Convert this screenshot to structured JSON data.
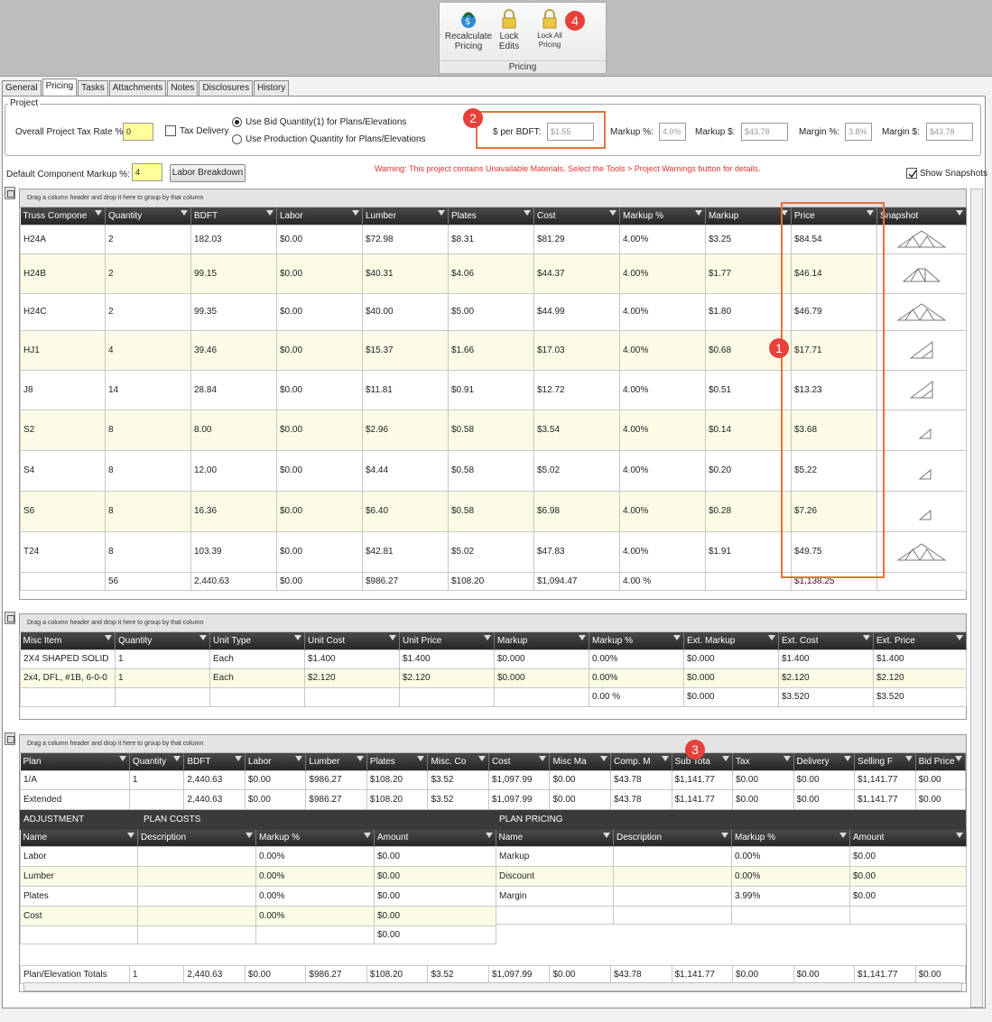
{
  "ribbon": {
    "recalc": "Recalculate Pricing",
    "lock_edits": "Lock Edits",
    "lock_all": "Lock All Pricing",
    "group": "Pricing",
    "badge": "4"
  },
  "tabs": [
    "General",
    "Pricing",
    "Tasks",
    "Attachments",
    "Notes",
    "Disclosures",
    "History"
  ],
  "project": {
    "legend": "Project",
    "tax_rate_label": "Overall Project Tax Rate %:",
    "tax_rate": "0",
    "tax_delivery": "Tax Delivery",
    "radio1": "Use Bid Quantity(1) for Plans/Elevations",
    "radio2": "Use Production Quantity for Plans/Elevations",
    "per_bdft_label": "$ per BDFT:",
    "per_bdft": "$1.55",
    "markup_pct_label": "Markup %:",
    "markup_pct": "4.0%",
    "markup_usd_label": "Markup $:",
    "markup_usd": "$43.78",
    "margin_pct_label": "Margin %:",
    "margin_pct": "3.8%",
    "margin_usd_label": "Margin $:",
    "margin_usd": "$43.78",
    "badge": "2"
  },
  "component": {
    "markup_label": "Default Component Markup %:",
    "markup": "4",
    "labor_btn": "Labor Breakdown",
    "warning": "Warning: This project contains Unavailable Materials. Select the Tools > Project Warnings button for details.",
    "show_snapshots": "Show Snapshots"
  },
  "drag_hint": "Drag a column header and drop it here to group by that column",
  "truss": {
    "headers": [
      "Truss Compone",
      "Quantity",
      "BDFT",
      "Labor",
      "Lumber",
      "Plates",
      "Cost",
      "Markup %",
      "Markup",
      "Price",
      "Snapshot"
    ],
    "rows": [
      [
        "H24A",
        "2",
        "182.03",
        "$0.00",
        "$72.98",
        "$8.31",
        "$81.29",
        "4.00%",
        "$3.25",
        "$84.54"
      ],
      [
        "H24B",
        "2",
        "99.15",
        "$0.00",
        "$40.31",
        "$4.06",
        "$44.37",
        "4.00%",
        "$1.77",
        "$46.14"
      ],
      [
        "H24C",
        "2",
        "99.35",
        "$0.00",
        "$40.00",
        "$5.00",
        "$44.99",
        "4.00%",
        "$1.80",
        "$46.79"
      ],
      [
        "HJ1",
        "4",
        "39.46",
        "$0.00",
        "$15.37",
        "$1.66",
        "$17.03",
        "4.00%",
        "$0.68",
        "$17.71"
      ],
      [
        "J8",
        "14",
        "28.84",
        "$0.00",
        "$11.81",
        "$0.91",
        "$12.72",
        "4.00%",
        "$0.51",
        "$13.23"
      ],
      [
        "S2",
        "8",
        "8.00",
        "$0.00",
        "$2.96",
        "$0.58",
        "$3.54",
        "4.00%",
        "$0.14",
        "$3.68"
      ],
      [
        "S4",
        "8",
        "12.00",
        "$0.00",
        "$4.44",
        "$0.58",
        "$5.02",
        "4.00%",
        "$0.20",
        "$5.22"
      ],
      [
        "S6",
        "8",
        "16.36",
        "$0.00",
        "$6.40",
        "$0.58",
        "$6.98",
        "4.00%",
        "$0.28",
        "$7.26"
      ],
      [
        "T24",
        "8",
        "103.39",
        "$0.00",
        "$42.81",
        "$5.02",
        "$47.83",
        "4.00%",
        "$1.91",
        "$49.75"
      ]
    ],
    "totals": [
      "",
      "56",
      "2,440.63",
      "$0.00",
      "$986.27",
      "$108.20",
      "$1,094.47",
      "4.00 %",
      "",
      "$1,138.25",
      ""
    ],
    "badge": "1"
  },
  "misc": {
    "headers": [
      "Misc Item",
      "Quantity",
      "Unit Type",
      "Unit Cost",
      "Unit Price",
      "Markup",
      "Markup %",
      "Ext. Markup",
      "Ext. Cost",
      "Ext. Price"
    ],
    "rows": [
      [
        "2X4 SHAPED SOLID",
        "1",
        "Each",
        "$1.400",
        "$1.400",
        "$0.000",
        "0.00%",
        "$0.000",
        "$1.400",
        "$1.400"
      ],
      [
        "2x4, DFL, #1B, 6-0-0",
        "1",
        "Each",
        "$2.120",
        "$2.120",
        "$0.000",
        "0.00%",
        "$0.000",
        "$2.120",
        "$2.120"
      ]
    ],
    "totals": [
      "",
      "",
      "",
      "",
      "",
      "",
      "0.00 %",
      "$0.000",
      "$3.520",
      "$3.520"
    ]
  },
  "plan": {
    "headers": [
      "Plan",
      "Quantity",
      "BDFT",
      "Labor",
      "Lumber",
      "Plates",
      "Misc. Co",
      "Cost",
      "Misc Ma",
      "Comp. M",
      "Sub Tota",
      "Tax",
      "Delivery",
      "Selling F",
      "Bid Price"
    ],
    "row": [
      "1/A",
      "1",
      "2,440.63",
      "$0.00",
      "$986.27",
      "$108.20",
      "$3.52",
      "$1,097.99",
      "$0.00",
      "$43.78",
      "$1,141.77",
      "$0.00",
      "$0.00",
      "$1,141.77",
      "$0.00"
    ],
    "ext": [
      "Extended",
      "",
      "2,440.63",
      "$0.00",
      "$986.27",
      "$108.20",
      "$3.52",
      "$1,097.99",
      "$0.00",
      "$43.78",
      "$1,141.77",
      "$0.00",
      "$0.00",
      "$1,141.77",
      "$0.00"
    ],
    "badge": "3",
    "adjustment": "ADJUSTMENT",
    "plan_costs": "PLAN COSTS",
    "plan_pricing": "PLAN PRICING",
    "cost_headers": [
      "Name",
      "Description",
      "Markup %",
      "Amount"
    ],
    "cost_rows": [
      [
        "Labor",
        "",
        "0.00%",
        "$0.00"
      ],
      [
        "Lumber",
        "",
        "0.00%",
        "$0.00"
      ],
      [
        "Plates",
        "",
        "0.00%",
        "$0.00"
      ],
      [
        "Cost",
        "",
        "0.00%",
        "$0.00"
      ]
    ],
    "cost_total": "$0.00",
    "price_headers": [
      "Name",
      "Description",
      "Markup %",
      "Amount"
    ],
    "price_rows": [
      [
        "Markup",
        "",
        "0.00%",
        "$0.00"
      ],
      [
        "Discount",
        "",
        "0.00%",
        "$0.00"
      ],
      [
        "Margin",
        "",
        "3.99%",
        "$0.00"
      ]
    ],
    "totals": [
      "Plan/Elevation Totals",
      "1",
      "2,440.63",
      "$0.00",
      "$986.27",
      "$108.20",
      "$3.52",
      "$1,097.99",
      "$0.00",
      "$43.78",
      "$1,141.77",
      "$0.00",
      "$0.00",
      "$1,141.77",
      "$0.00"
    ]
  },
  "colors": {
    "badge": "#e8403a",
    "highlight": "#e8703a",
    "header": "#2e2e2e",
    "yellow": "#ffff9a",
    "warning": "#e03030"
  }
}
